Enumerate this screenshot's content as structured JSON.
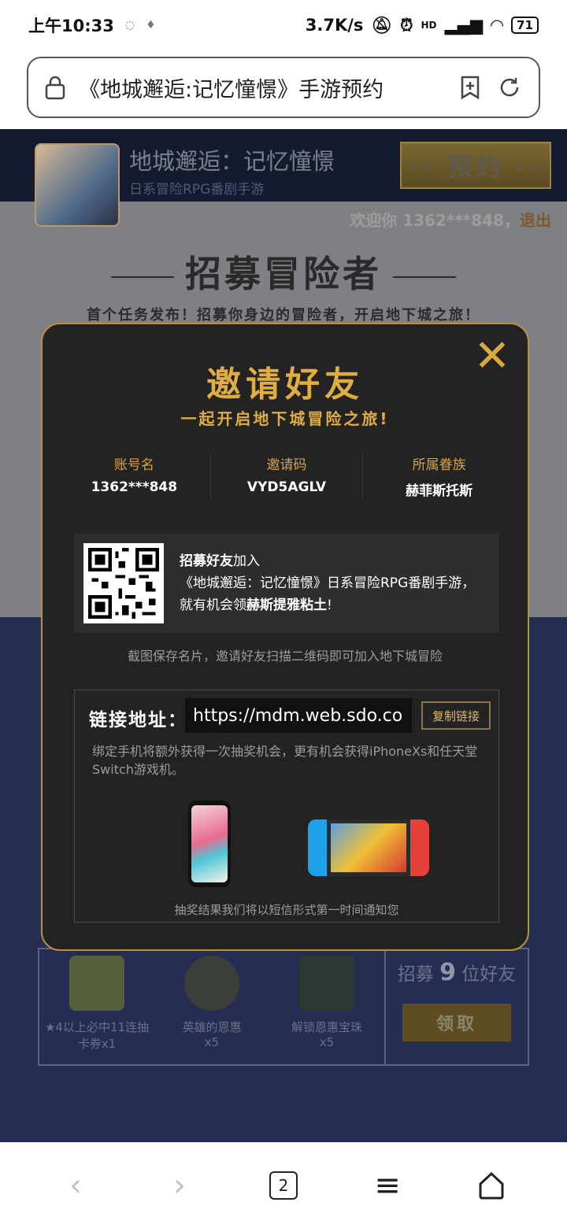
{
  "status": {
    "time": "上午10:33",
    "speed": "3.7K/s",
    "signal": "HD",
    "battery": "71"
  },
  "browser": {
    "url": "《地城邂逅:记忆憧憬》手游预约"
  },
  "header": {
    "app_title": "地城邂逅：记忆憧憬",
    "app_subtitle": "日系冒险RPG番剧手游",
    "reserve_label": "·· 预约 ··",
    "welcome": "欢迎你 1362***848，",
    "logout": "退出"
  },
  "hero": {
    "title": "招募冒险者",
    "subtitle": "首个任务发布！招募你身边的冒险者，开启地下城之旅！"
  },
  "rewards": {
    "items": [
      {
        "label": "★4以上必中11连抽卡券x1"
      },
      {
        "label": "英雄的恩惠",
        "qty": "x5"
      },
      {
        "label": "解锁恩惠宝珠",
        "qty": "x5"
      }
    ],
    "recruit_prefix": "招募",
    "recruit_count": "9",
    "recruit_suffix": "位好友",
    "claim_label": "领取"
  },
  "modal": {
    "title": "邀请好友",
    "subtitle": "一起开启地下城冒险之旅!",
    "fields": [
      {
        "key": "账号名",
        "value": "1362***848"
      },
      {
        "key": "邀请码",
        "value": "VYD5AGLV"
      },
      {
        "key": "所属眷族",
        "value": "赫菲斯托斯"
      }
    ],
    "qr_text_bold": "招募好友",
    "qr_text_join": "加入",
    "qr_text_line2": "《地城邂逅：记忆憧憬》日系冒险RPG番剧手游，",
    "qr_text_line3_pre": "就有机会领",
    "qr_text_line3_bold": "赫斯提雅粘土",
    "qr_text_line3_end": "!",
    "hint": "截图保存名片，邀请好友扫描二维码即可加入地下城冒险",
    "link_label": "链接地址：",
    "link_url": "https://mdm.web.sdo.co",
    "copy_label": "复制链接",
    "bind_text": "绑定手机将额外获得一次抽奖机会，更有机会获得iPhoneXs和任天堂Switch游戏机。",
    "result_text": "抽奖结果我们将以短信形式第一时间通知您"
  },
  "nav": {
    "tab_count": "2"
  }
}
